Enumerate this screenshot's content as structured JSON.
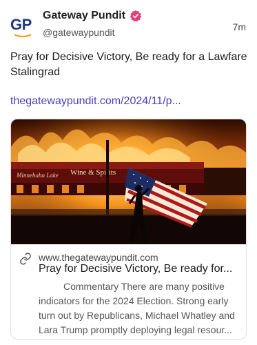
{
  "author": {
    "display_name": "Gateway Pundit",
    "handle": "@gatewaypundit",
    "avatar_text": "GP",
    "verified_color": "#e0407a"
  },
  "post": {
    "time": "7m",
    "text": "Pray for Decisive Victory, Be ready for a Lawfare Stalingrad",
    "link_text": "thegatewaypundit.com/2024/11/p..."
  },
  "card": {
    "image_icon": "burning-building-flag-photo",
    "domain": "www.thegatewaypundit.com",
    "title": "Pray for Decisive Victory, Be ready for...",
    "description": "Commentary There are many positive indicators for the 2024 Election.  Strong early turn out by Republicans, Michael Whatley and Lara Trump promptly deploying legal resour..."
  },
  "colors": {
    "link": "#4a3fb5",
    "brand_blue": "#1f3a7a",
    "brand_orange": "#f0a020"
  }
}
